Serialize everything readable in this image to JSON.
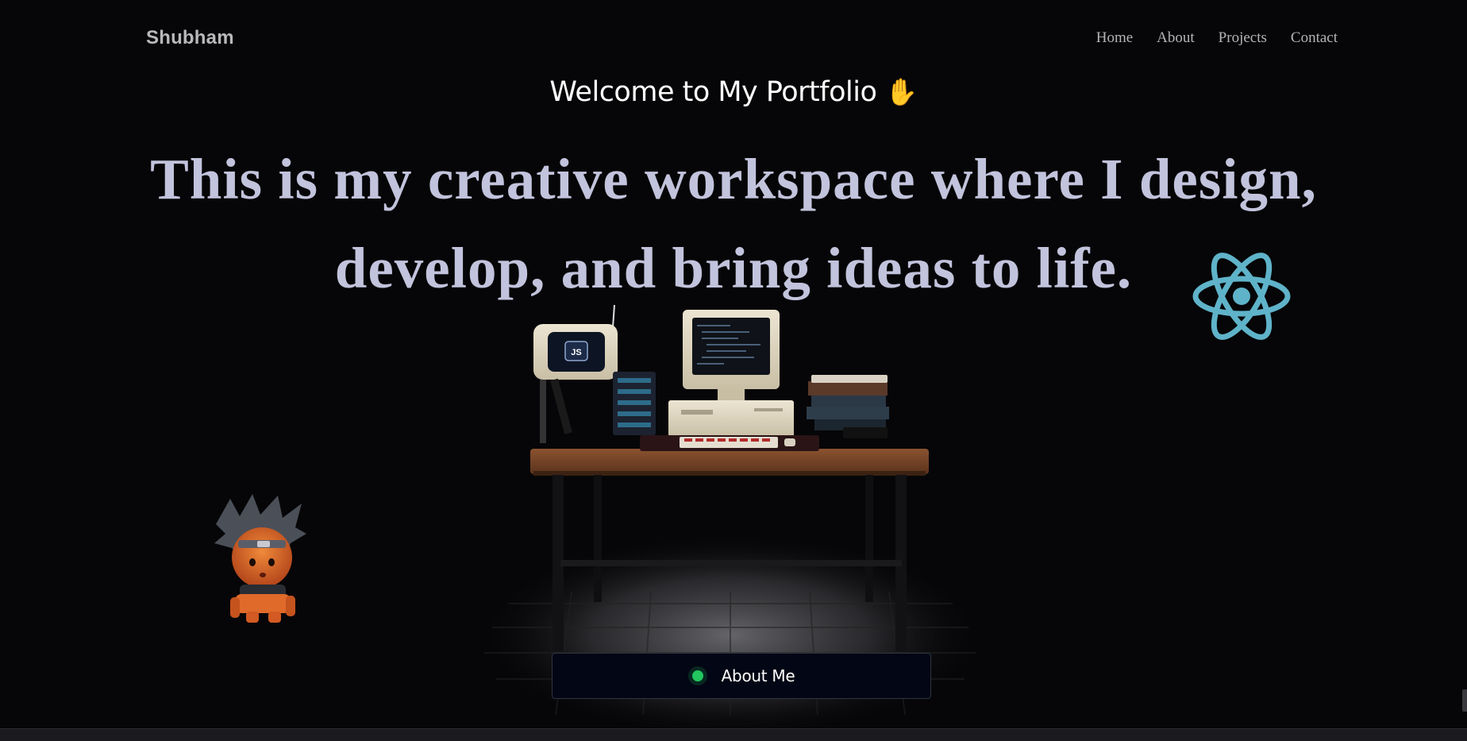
{
  "nav": {
    "brand": "Shubham",
    "links": [
      "Home",
      "About",
      "Projects",
      "Contact"
    ]
  },
  "hero": {
    "welcome": "Welcome to My Portfolio",
    "wave_emoji": "✋",
    "tagline": "This is my creative workspace where I design, develop, and bring ideas to life."
  },
  "scene": {
    "monitor_badge": "JS",
    "icons": [
      "react-icon",
      "desk-setup-illustration",
      "ninja-character-illustration"
    ]
  },
  "cta": {
    "about_label": "About Me",
    "status_color": "#22c55e"
  },
  "colors": {
    "background": "#060608",
    "tagline": "#c2c3dc",
    "react_accent": "#5fb3c9"
  }
}
